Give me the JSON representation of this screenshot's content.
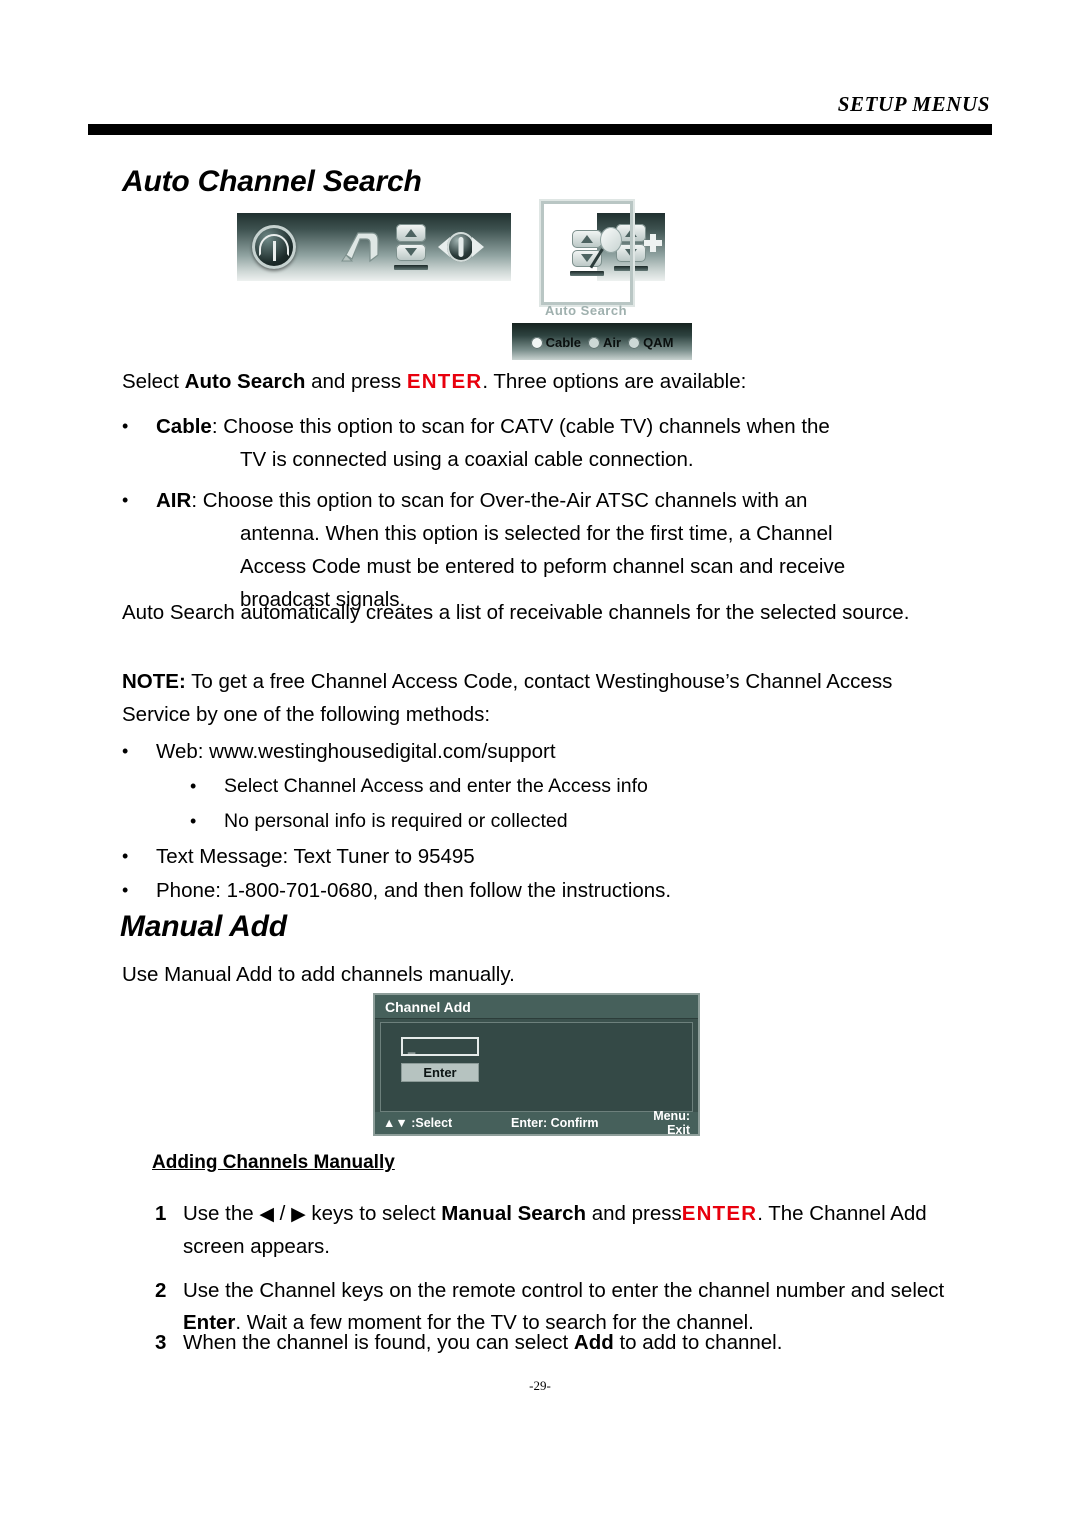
{
  "header": {
    "title": "SETUP MENUS"
  },
  "sections": {
    "auto_channel_search": {
      "heading": "Auto Channel Search"
    },
    "manual_add": {
      "heading": "Manual Add",
      "intro": "Use Manual Add to add channels manually.",
      "sub_heading": "Adding Channels Manually"
    }
  },
  "osd_graphic": {
    "icons": [
      "antenna-broadcast-icon",
      "swoosh-arrow-icon",
      "channel-updown-icon",
      "globe-tuning-icon",
      "auto-search-icon",
      "channel-add-icon"
    ],
    "selected_label": "Auto Search",
    "source_options": [
      {
        "label": "Cable",
        "selected": true
      },
      {
        "label": "Air",
        "selected": false
      },
      {
        "label": "QAM",
        "selected": false
      }
    ]
  },
  "intro_paragraph": {
    "part1": "Select ",
    "bold1": "Auto Search",
    "part2": " and press ",
    "enter": "ENTER",
    "part3": ". Three options are available:"
  },
  "bullets": {
    "cable": {
      "marker": "•",
      "bold": "Cable",
      "line1": ": Choose this option to scan for CATV (cable TV) channels when the",
      "line2": "TV is connected using a coaxial cable connection."
    },
    "air": {
      "marker": "•",
      "bold": "AIR",
      "line1": ": Choose this option to scan for Over-the-Air ATSC channels with an",
      "line2": "antenna. When this option is selected for the first time, a Channel",
      "line3": "Access Code must be entered to peform channel scan and receive",
      "line4": "broadcast signals."
    }
  },
  "auto_search_paragraph": "Auto Search automatically creates a list of receivable channels for the selected source.",
  "note_paragraph": {
    "label": "NOTE:",
    "text": " To get a free Channel Access Code, contact Westinghouse’s Channel Access Service by one of the following methods:"
  },
  "contact_methods": [
    {
      "marker": "•",
      "text": "Web: www.westinghousedigital.com/support"
    },
    {
      "marker": "•",
      "text": "Select Channel Access and enter the Access info",
      "sub": true
    },
    {
      "marker": "•",
      "text": "No personal info is required or collected",
      "sub": true
    },
    {
      "marker": "•",
      "text": "Text Message: Text Tuner to 95495"
    },
    {
      "marker": "•",
      "text": "Phone: 1-800-701-0680, and then follow the instructions."
    }
  ],
  "channel_add_dialog": {
    "title": "Channel Add",
    "input_value": "_",
    "enter_button": "Enter",
    "footer": {
      "select": "▲▼ :Select",
      "confirm": "Enter: Confirm",
      "exit": "Menu: Exit"
    }
  },
  "steps": [
    {
      "number": "1",
      "part1": "Use the ",
      "arrow_left": "◀",
      "slash": " / ",
      "arrow_right": "▶",
      "part2": " keys to select ",
      "bold1": "Manual Search",
      "part3": " and press",
      "enter": "ENTER",
      "part4": ". The Channel Add screen appears."
    },
    {
      "number": "2",
      "part1": "Use the Channel keys on the remote control to enter the channel number and select ",
      "bold1": "Enter",
      "part2": ". Wait a few moment for the TV to search for the channel."
    },
    {
      "number": "3",
      "part1": "When the channel is found, you can select ",
      "bold1": "Add",
      "part2": " to add to channel."
    }
  ],
  "footer": {
    "page_number": "-29-"
  },
  "colors": {
    "enter_red": "#e8000d",
    "osd_dark": "#344946",
    "osd_title": "#46605b",
    "rule_black": "#000000"
  }
}
